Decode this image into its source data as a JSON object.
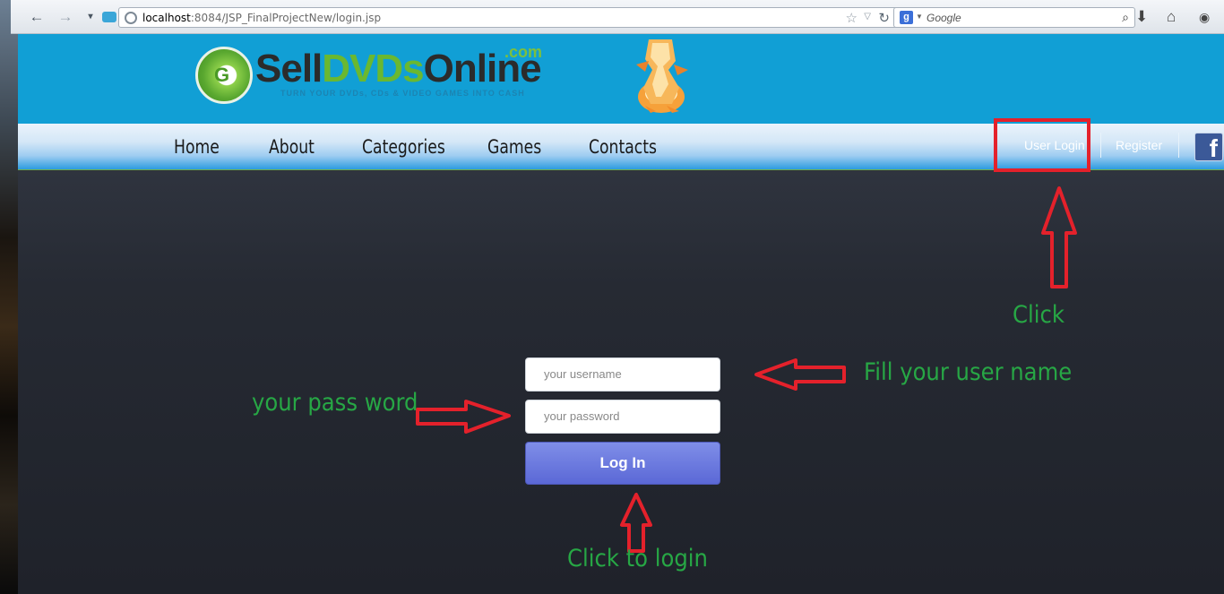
{
  "browser": {
    "url_host": "localhost",
    "url_rest": ":8084/JSP_FinalProjectNew/login.jsp",
    "search_placeholder": "Google"
  },
  "site": {
    "logo": {
      "name_part1": "Sell",
      "name_part2": "DVDs",
      "name_part3": "Online",
      "com": ".com",
      "tagline": "TURN YOUR DVDs, CDs & VIDEO GAMES INTO CASH"
    },
    "nav": {
      "items": [
        "Home",
        "About",
        "Categories",
        "Games",
        "Contacts"
      ],
      "user_login": "User Login",
      "register": "Register"
    },
    "login": {
      "username_placeholder": "your username",
      "password_placeholder": "your password",
      "button": "Log In"
    }
  },
  "annotations": {
    "click": "Click",
    "fill_username": "Fill your user name",
    "password": "your pass word",
    "click_to_login": "Click to login",
    "color": "#27a745",
    "arrow_color": "#e4212b"
  },
  "colors": {
    "header_blue": "#119fd5",
    "page_bg": "#262a33",
    "button": "#6b79de"
  }
}
